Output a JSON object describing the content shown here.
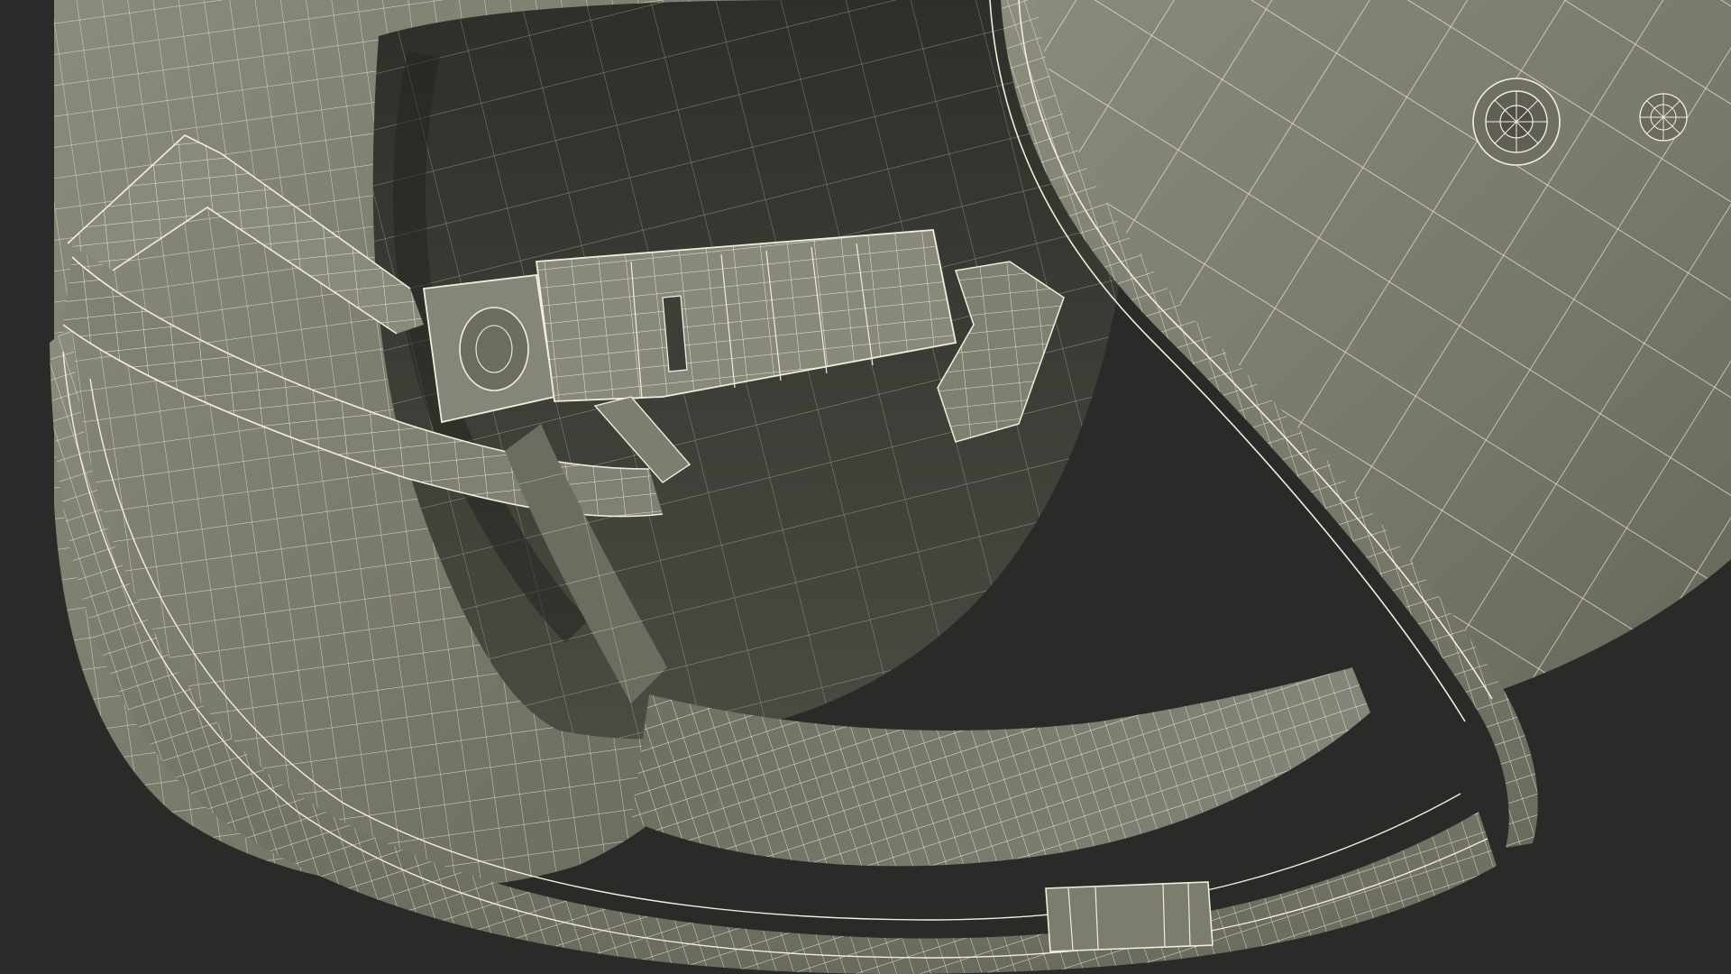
{
  "scene": {
    "subject": "helmet-wireframe-render",
    "colors": {
      "background": "#2a2a28",
      "shell_surface": "#7a7a6c",
      "shell_light": "#8d8d7e",
      "shell_dark": "#5c5c52",
      "interior": "#3c3d36",
      "interior_deep": "#2f302b",
      "wire": "#f1efdc",
      "wire_dim": "#cfcdb9"
    },
    "icons": [
      "rivet-icon",
      "vent-icon"
    ]
  }
}
